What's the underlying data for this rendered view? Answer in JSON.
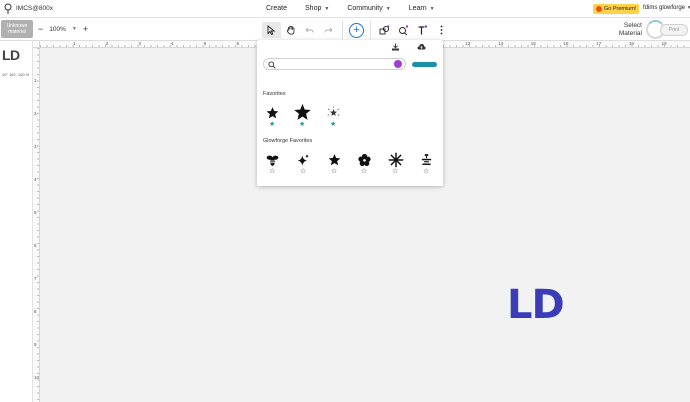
{
  "topbar": {
    "doc_title": "IMCS@800x",
    "nav": [
      {
        "label": "Create",
        "chevron": false
      },
      {
        "label": "Shop",
        "chevron": true
      },
      {
        "label": "Community",
        "chevron": true
      },
      {
        "label": "Learn",
        "chevron": true
      }
    ],
    "premium_label": "Go Premium!",
    "user_name": "fdims glowforge"
  },
  "toolbar": {
    "material_label": "Unknown material",
    "zoom_value": "100%",
    "select_material_label": "Select Material",
    "print_label": "Print"
  },
  "thumbnail": {
    "logo_text": "LD",
    "caption": "10\" 162, 100 %"
  },
  "rulers": {
    "top": [
      "1",
      "2",
      "3",
      "4",
      "5",
      "6",
      "7",
      "8",
      "9",
      "10",
      "11",
      "12",
      "13",
      "14",
      "15",
      "16",
      "17",
      "18",
      "19"
    ],
    "left": [
      "1",
      "2",
      "3",
      "4",
      "5",
      "6",
      "7",
      "8",
      "9",
      "10"
    ]
  },
  "canvas": {
    "design_text": "LD",
    "design_color": "#3b3cb8"
  },
  "popup": {
    "favorites_title": "Favorites",
    "favorites": [
      {
        "icon": "star-5-icon",
        "starred": true
      },
      {
        "icon": "star-5-large-icon",
        "starred": true
      },
      {
        "icon": "sparkle-star-icon",
        "starred": true
      }
    ],
    "glowforge_title": "Glowforge Favorites",
    "glowforge_favorites": [
      {
        "icon": "bee-icon",
        "starred": false
      },
      {
        "icon": "sparkle-icon",
        "starred": false
      },
      {
        "icon": "star-5-icon",
        "starred": false
      },
      {
        "icon": "flower-icon",
        "starred": false
      },
      {
        "icon": "asterisk-burst-icon",
        "starred": false
      },
      {
        "icon": "lamp-icon",
        "starred": false
      }
    ]
  },
  "colors": {
    "accent": "#1a73c9",
    "teal": "#1b8fa3",
    "premium": "#ffd24a",
    "star_filled": "#1a94b8"
  }
}
